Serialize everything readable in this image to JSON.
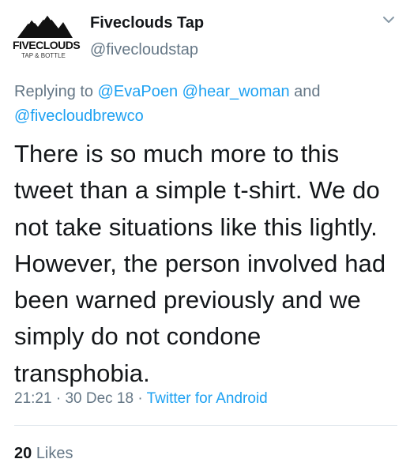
{
  "author": {
    "display_name": "Fiveclouds Tap",
    "handle": "@fivecloudstap",
    "avatar_logo_text": "FIVECLOUDS",
    "avatar_logo_subtext": "TAP & BOTTLE",
    "avatar_icon": "mountain-logo"
  },
  "menu_icon": "chevron-down-icon",
  "reply": {
    "prefix": "Replying to",
    "mention_1": "@EvaPoen",
    "mention_2": "@hear_woman",
    "conjunction": "and",
    "mention_3": "@fivecloudbrewco"
  },
  "tweet_text": "There is so much more to this tweet than a simple t-shirt. We do not take situations like this lightly. However, the person involved had been warned previously and we simply do not condone transphobia.",
  "meta": {
    "time": "21:21",
    "separator": "·",
    "date": "30 Dec 18",
    "source": "Twitter for Android"
  },
  "stats": {
    "likes_count": "20",
    "likes_label": "Likes"
  },
  "colors": {
    "link": "#1da1f2",
    "secondary_text": "#657786",
    "primary_text": "#14171a"
  }
}
